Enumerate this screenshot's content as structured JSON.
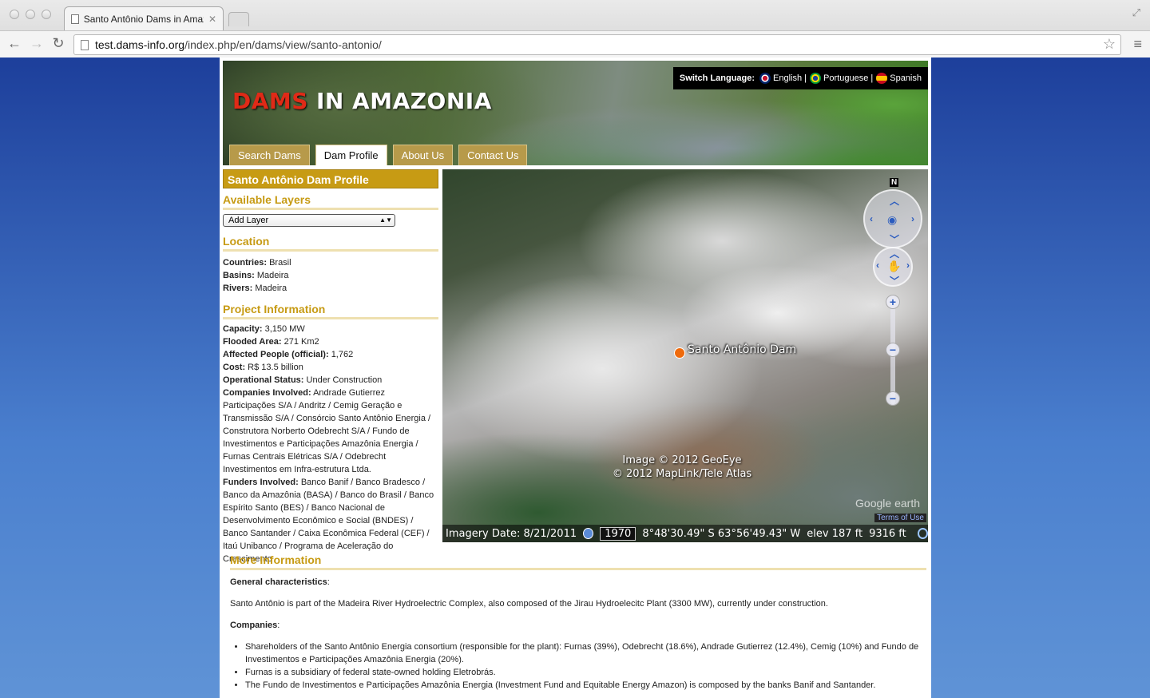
{
  "browser": {
    "tab_title": "Santo Antônio Dams in Amaz",
    "url_host": "test.dams-info.org",
    "url_path": "/index.php/en/dams/view/santo-antonio/"
  },
  "header": {
    "logo_red": "DAMS",
    "logo_white": "IN AMAZONIA",
    "switch_label": "Switch Language:",
    "languages": [
      {
        "label": "English |",
        "flag": "uk-flag"
      },
      {
        "label": "Portuguese |",
        "flag": "brazil-flag"
      },
      {
        "label": "Spanish",
        "flag": "spain-flag"
      }
    ],
    "nav_tabs": [
      "Search Dams",
      "Dam Profile",
      "About Us",
      "Contact Us"
    ],
    "active_tab": "Dam Profile"
  },
  "sidebar": {
    "profile_title": "Santo Antônio Dam Profile",
    "layers_heading": "Available Layers",
    "layer_select": "Add Layer",
    "location_heading": "Location",
    "location": [
      {
        "label": "Countries:",
        "value": "Brasil"
      },
      {
        "label": "Basins:",
        "value": "Madeira"
      },
      {
        "label": "Rivers:",
        "value": "Madeira"
      }
    ],
    "project_heading": "Project Information",
    "project": [
      {
        "label": "Capacity:",
        "value": "3,150 MW"
      },
      {
        "label": "Flooded Area:",
        "value": "271 Km2"
      },
      {
        "label": "Affected People (official):",
        "value": "1,762"
      },
      {
        "label": "Cost:",
        "value": "R$ 13.5 billion"
      },
      {
        "label": "Operational Status:",
        "value": "Under Construction"
      },
      {
        "label": "Companies Involved:",
        "value": "Andrade Gutierrez Participações S/A / Andritz / Cemig Geração e Transmissão S/A / Consórcio Santo Antônio Energia / Construtora Norberto Odebrecht S/A / Fundo de Investimentos e Participações Amazônia Energia / Furnas Centrais Elétricas S/A / Odebrecht Investimentos em Infra-estrutura Ltda."
      },
      {
        "label": "Funders Involved:",
        "value": "Banco Banif / Banco Bradesco / Banco da Amazônia (BASA) / Banco do Brasil / Banco Espírito Santo (BES) / Banco Nacional de Desenvolvimento Econômico e Social (BNDES) / Banco Santander / Caixa Econômica Federal (CEF) / Itaú Unibanco / Programa de Aceleração do Crescimento"
      }
    ]
  },
  "map": {
    "marker_label": "Santo Antônio Dam",
    "copyright_1": "Image © 2012 GeoEye",
    "copyright_2": "© 2012 MapLink/Tele Atlas",
    "google_earth": "Google earth",
    "terms": "Terms of Use",
    "compass_n": "N",
    "imagery_date": "Imagery Date: 8/21/2011",
    "year": "1970",
    "coords": "8°48'30.49\" S   63°56'49.43\" W",
    "elev": "elev 187 ft",
    "eye_alt": "9316 ft"
  },
  "more": {
    "heading": "More Information",
    "general_label": "General characteristics",
    "general_colon": ":",
    "general_text": "Santo Antônio is part of the Madeira River Hydroelectric Complex, also composed of the Jirau Hydroelecitc Plant (3300 MW), currently under construction.",
    "companies_label": "Companies",
    "companies_colon": ":",
    "bullets": [
      "Shareholders of the Santo Antônio Energia consortium (responsible for the plant): Furnas (39%), Odebrecht (18.6%), Andrade Gutierrez (12.4%), Cemig (10%) and Fundo de Investimentos e Participações Amazônia Energia (20%).",
      "Furnas  is a subsidiary of federal state-owned holding Eletrobrás.",
      "The Fundo de Investimentos e Participações Amazônia Energia (Investment Fund and Equitable Energy Amazon) is composed  by the banks Banif and Santander."
    ]
  }
}
